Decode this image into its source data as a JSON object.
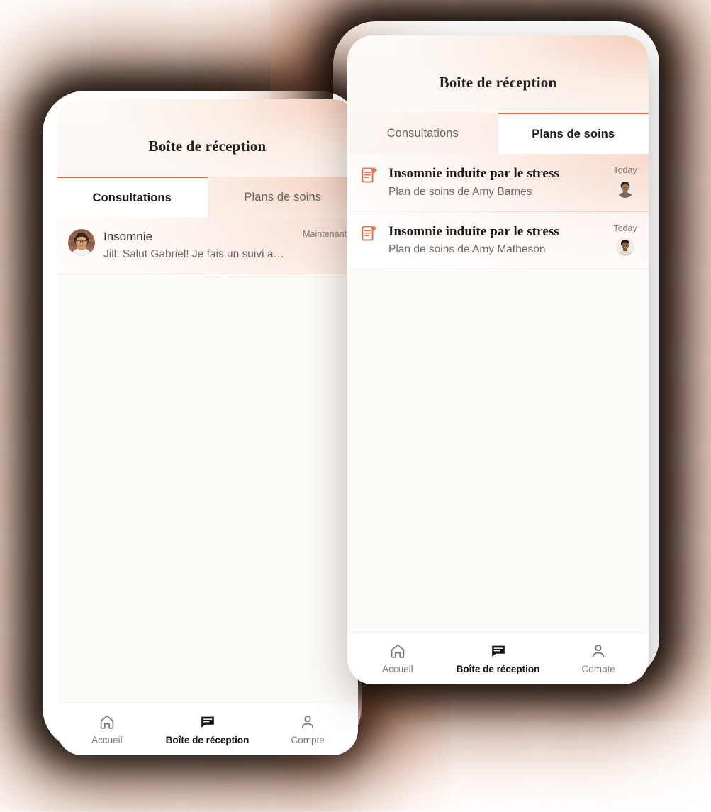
{
  "background": {
    "page_color": "#ffffff",
    "glow_color": "#EB804C",
    "shadow_color": "#140C08"
  },
  "theme": {
    "accent": "#E2714A",
    "surface": "#FDFBF8",
    "text_primary": "#1C1916",
    "text_secondary": "#6D6864"
  },
  "phones": [
    {
      "id": "back-phone",
      "header": {
        "title": "Boîte de réception"
      },
      "tabs": [
        {
          "label": "Consultations",
          "active": true
        },
        {
          "label": "Plans de soins",
          "active": false
        }
      ],
      "list": [
        {
          "lead_icon": "avatar",
          "avatar": "woman-glasses-brick-wall",
          "title": "Insomnie",
          "subtitle": "Jill: Salut Gabriel! Je fais un suivi avec vous...",
          "time": "Maintenant"
        }
      ],
      "bottom_nav": [
        {
          "label": "Accueil",
          "icon": "home-icon",
          "active": false
        },
        {
          "label": "Boîte de réception",
          "icon": "chat-message-icon",
          "active": true
        },
        {
          "label": "Compte",
          "icon": "person-icon",
          "active": false
        }
      ]
    },
    {
      "id": "front-phone",
      "header": {
        "title": "Boîte de réception"
      },
      "tabs": [
        {
          "label": "Consultations",
          "active": false
        },
        {
          "label": "Plans de soins",
          "active": true
        }
      ],
      "list": [
        {
          "lead_icon": "document-plus-icon",
          "title": "Insomnie induite par le stress",
          "subtitle": "Plan de soins de Amy Barnes",
          "time": "Today",
          "avatar": "smiling-woman-portrait"
        },
        {
          "lead_icon": "document-plus-icon",
          "title": "Insomnie induite par le stress",
          "subtitle": "Plan de soins de Amy Matheson",
          "time": "Today",
          "avatar": "smiling-person-portrait"
        }
      ],
      "bottom_nav": [
        {
          "label": "Accueil",
          "icon": "home-icon",
          "active": false
        },
        {
          "label": "Boîte de réception",
          "icon": "chat-message-icon",
          "active": true
        },
        {
          "label": "Compte",
          "icon": "person-icon",
          "active": false
        }
      ]
    }
  ]
}
